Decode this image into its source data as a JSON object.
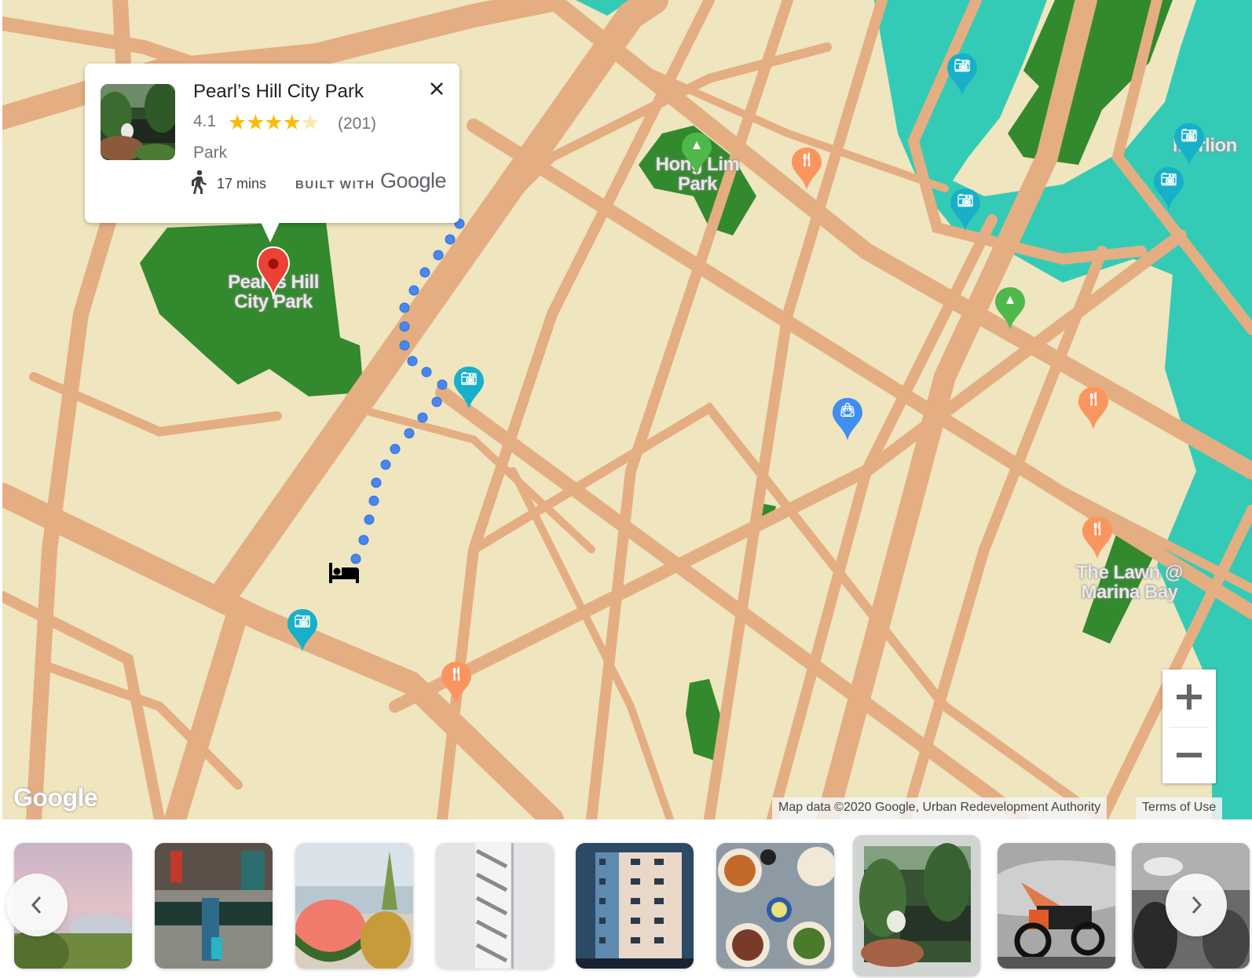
{
  "map": {
    "labels": {
      "pearls_hill": "Pearl's Hill City Park",
      "hong_lim": "Hong Lim Park",
      "lawn_marina": "The Lawn @ Marina Bay",
      "merlion": "Merlion"
    },
    "colors": {
      "land": "#efe5bf",
      "road": "#e4ae82",
      "park": "#33892d",
      "water": "#34cbb6",
      "route_dot": "#4a86f0",
      "pin_red": "#ea4335",
      "pin_attraction": "#17b0c8",
      "pin_food": "#fb9560",
      "pin_park": "#4fb84a",
      "pin_shopping": "#3f8ef0"
    },
    "markers": [
      {
        "type": "selected-place",
        "icon": "map-pin-icon"
      },
      {
        "type": "attraction",
        "icon": "camera-icon"
      },
      {
        "type": "attraction",
        "icon": "camera-icon"
      },
      {
        "type": "attraction",
        "icon": "camera-icon"
      },
      {
        "type": "attraction",
        "icon": "camera-icon"
      },
      {
        "type": "attraction",
        "icon": "camera-icon"
      },
      {
        "type": "attraction",
        "icon": "camera-icon"
      },
      {
        "type": "restaurant",
        "icon": "fork-knife-icon"
      },
      {
        "type": "restaurant",
        "icon": "fork-knife-icon"
      },
      {
        "type": "restaurant",
        "icon": "fork-knife-icon"
      },
      {
        "type": "restaurant",
        "icon": "fork-knife-icon"
      },
      {
        "type": "park",
        "icon": "tree-icon"
      },
      {
        "type": "park",
        "icon": "tree-icon"
      },
      {
        "type": "shopping",
        "icon": "shopping-bag-icon"
      },
      {
        "type": "hotel",
        "icon": "bed-icon"
      }
    ],
    "google_logo": "Google",
    "attribution": "Map data ©2020 Google, Urban Redevelopment Authority",
    "terms": "Terms of Use",
    "zoom_in": "+",
    "zoom_out": "−"
  },
  "card": {
    "title": "Pearl’s Hill City Park",
    "rating": "4.1",
    "stars_filled": 4,
    "stars_total": 5,
    "stars_text": "★★★★",
    "stars_dim_text": "★",
    "review_count": "(201)",
    "type": "Park",
    "walk_time": "17 mins",
    "built_with": "BUILT WITH",
    "google": "Google"
  },
  "carousel": {
    "photos": [
      {
        "name": "gardens-by-the-bay-photo"
      },
      {
        "name": "street-hawker-photo"
      },
      {
        "name": "watermelon-pineapple-photo"
      },
      {
        "name": "white-building-stairs-photo"
      },
      {
        "name": "apartment-block-photo"
      },
      {
        "name": "noodle-bowls-photo"
      },
      {
        "name": "pearls-hill-pond-photo",
        "selected": true
      },
      {
        "name": "motorcycle-mural-photo"
      },
      {
        "name": "crowd-bw-photo"
      }
    ]
  }
}
